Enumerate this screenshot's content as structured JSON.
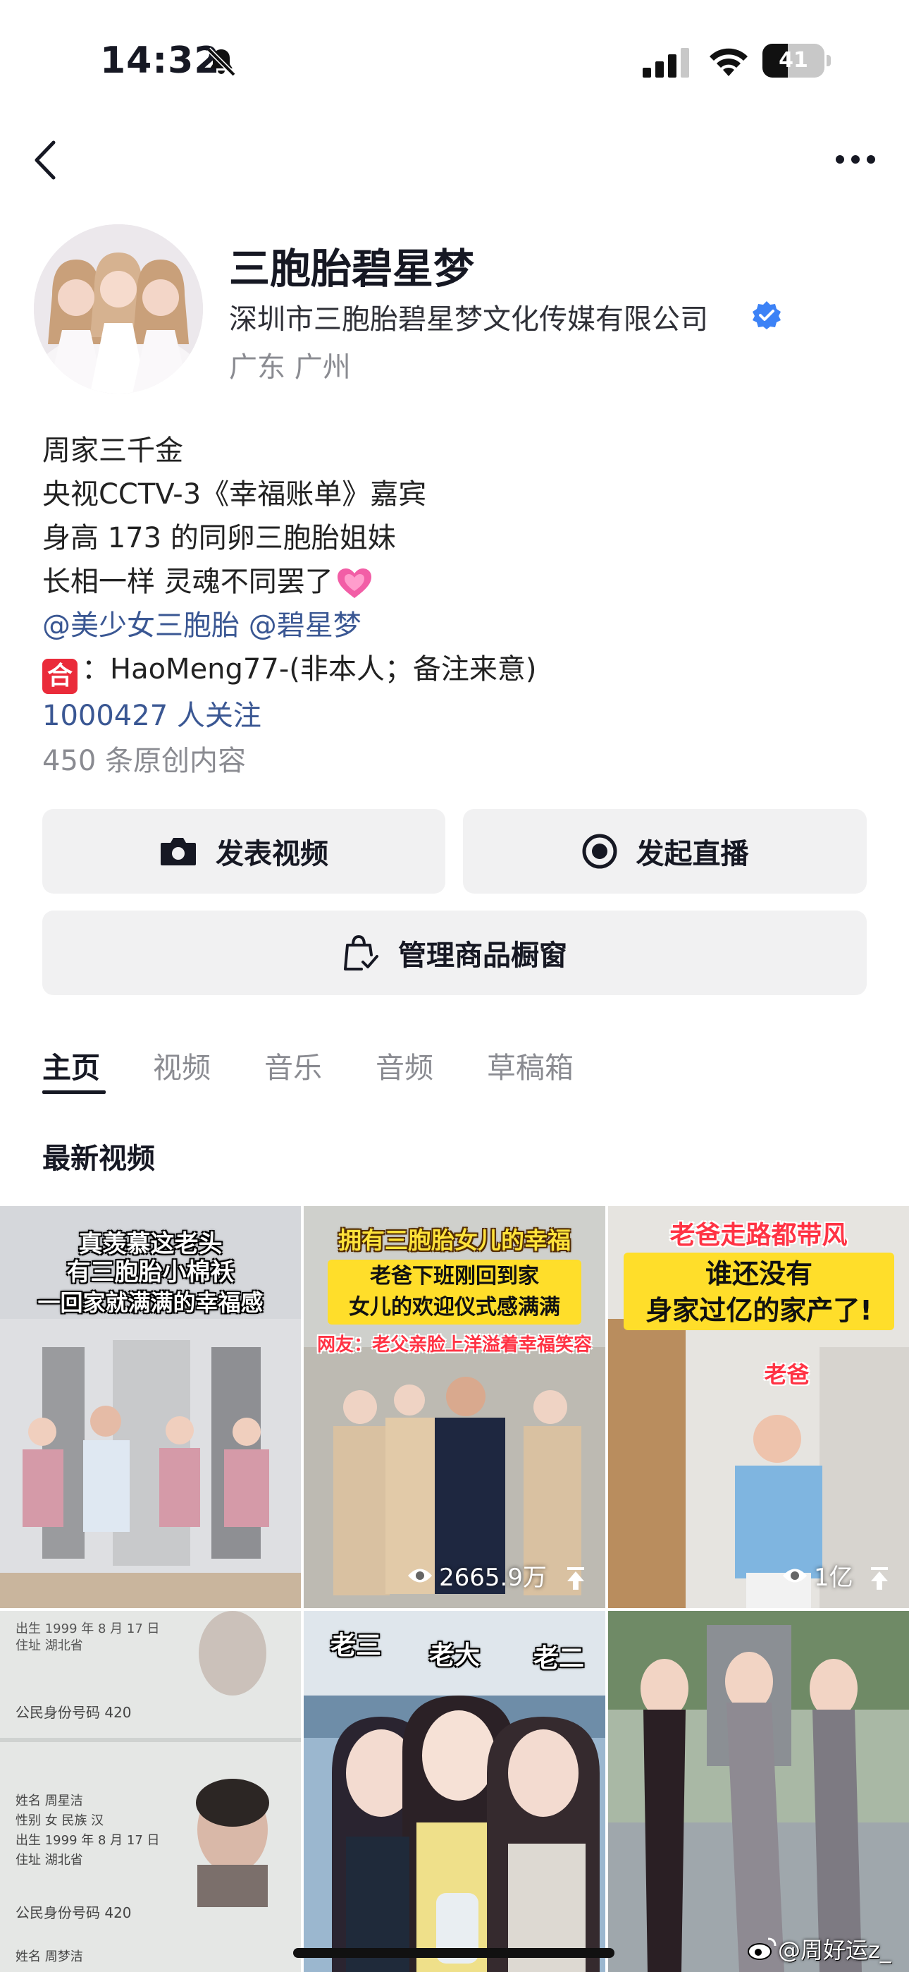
{
  "status_bar": {
    "time": "14:32",
    "battery_level": "41",
    "icons": [
      "bell-slash-icon",
      "signal-icon",
      "wifi-icon",
      "battery-icon"
    ]
  },
  "nav": {
    "back_icon": "chevron-left-icon",
    "more_icon": "more-horizontal-icon"
  },
  "profile": {
    "name": "三胞胎碧星梦",
    "company": "深圳市三胞胎碧星梦文化传媒有限公司",
    "location": "广东 广州",
    "verified_color": "#3c82f6"
  },
  "bio": {
    "line1": "周家三千金",
    "line2": "央视CCTV-3《幸福账单》嘉宾",
    "line3": "身高 173 的同卵三胞胎姐妹",
    "line4": "长相一样 灵魂不同罢了",
    "mention1": "@美少女三胞胎",
    "mention2": "@碧星梦",
    "cooperation_badge": "合",
    "contact": "：HaoMeng77-(非本人；备注来意)",
    "followers": "1000427 人关注",
    "original_count": "450 条原创内容"
  },
  "actions": {
    "post_video": "发表视频",
    "start_live": "发起直播",
    "manage_shop": "管理商品橱窗"
  },
  "tabs": [
    "主页",
    "视频",
    "音乐",
    "音频",
    "草稿箱"
  ],
  "section_title": "最新视频",
  "videos": [
    {
      "cap1": "真羡慕这老头",
      "cap2": "有三胞胎小棉袄",
      "cap3": "一回家就满满的幸福感"
    },
    {
      "cap1": "拥有三胞胎女儿的幸福",
      "cap2": "老爸下班刚回到家",
      "cap3": "女儿的欢迎仪式感满满",
      "cap4": "网友：老父亲脸上洋溢着幸福笑容",
      "views": "2665.9万"
    },
    {
      "cap1": "老爸走路都带风",
      "cap2": "谁还没有",
      "cap3": "身家过亿的家产了!",
      "cap4": "老爸",
      "views": "1亿"
    },
    {
      "id_line1": "出生  1999 年 8 月 17 日",
      "id_line2": "住址  湖北省",
      "id_line3": "公民身份号码   420",
      "id_line4": "姓名  周星洁",
      "id_line5": "性别  女   民族 汉",
      "id_line6": "出生  1999 年 8 月 17 日",
      "id_line7": "住址  湖北省",
      "id_line8": "公民身份号码   420",
      "id_line9": "姓名  周梦洁"
    },
    {
      "cap1": "老三",
      "cap2": "老大",
      "cap3": "老二"
    },
    {}
  ],
  "watermark": "@周好运z_"
}
